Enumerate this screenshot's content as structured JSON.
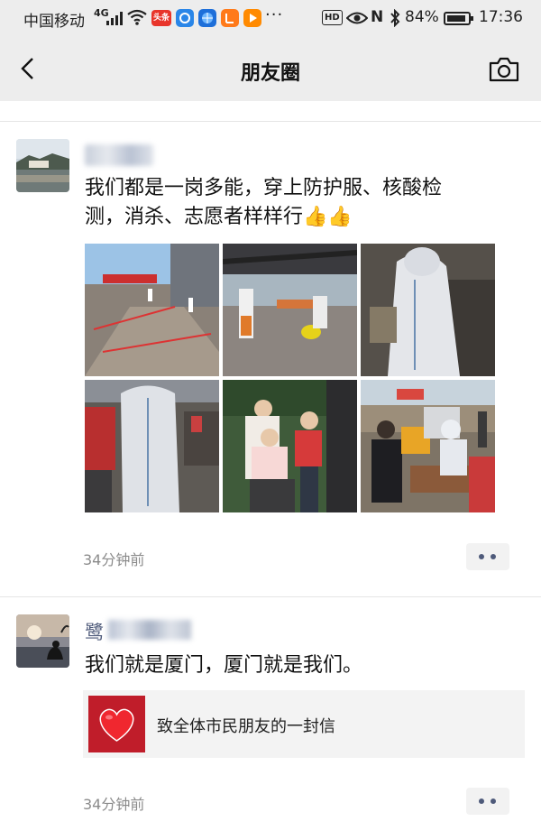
{
  "status_bar": {
    "carrier": "中国移动",
    "network": "4G",
    "app_badge_1": "头条",
    "more_indicator": "···",
    "hd_label": "HD",
    "nfc_label": "N",
    "battery": "84%",
    "time": "17:36",
    "icons": [
      "signal-icon",
      "wifi-icon",
      "toutiao-app-icon",
      "circle-app-icon",
      "globe-app-icon",
      "video-app-icon",
      "play-app-icon",
      "eye-icon",
      "nfc-icon",
      "bluetooth-icon",
      "battery-icon"
    ]
  },
  "nav": {
    "title": "朋友圈",
    "back_icon": "back-arrow-icon",
    "camera_icon": "camera-icon"
  },
  "posts": [
    {
      "text_line_1": "我们都是一岗多能，穿上防护服、核酸检",
      "text_line_2": "测，消杀、志愿者样样行👍👍",
      "photo_count": 6,
      "time": "34分钟前",
      "more_icon": "more-dots-icon"
    },
    {
      "name_visible_char": "鹭",
      "text": "我们就是厦门，厦门就是我们。",
      "link_title": "致全体市民朋友的一封信",
      "link_icon": "heart-icon",
      "time": "34分钟前",
      "more_icon": "more-dots-icon"
    }
  ],
  "colors": {
    "nav_background": "#ededed",
    "link_accent": "#4e5a7a",
    "time_text": "#8b8b8b",
    "heart_red": "#e8202a"
  }
}
